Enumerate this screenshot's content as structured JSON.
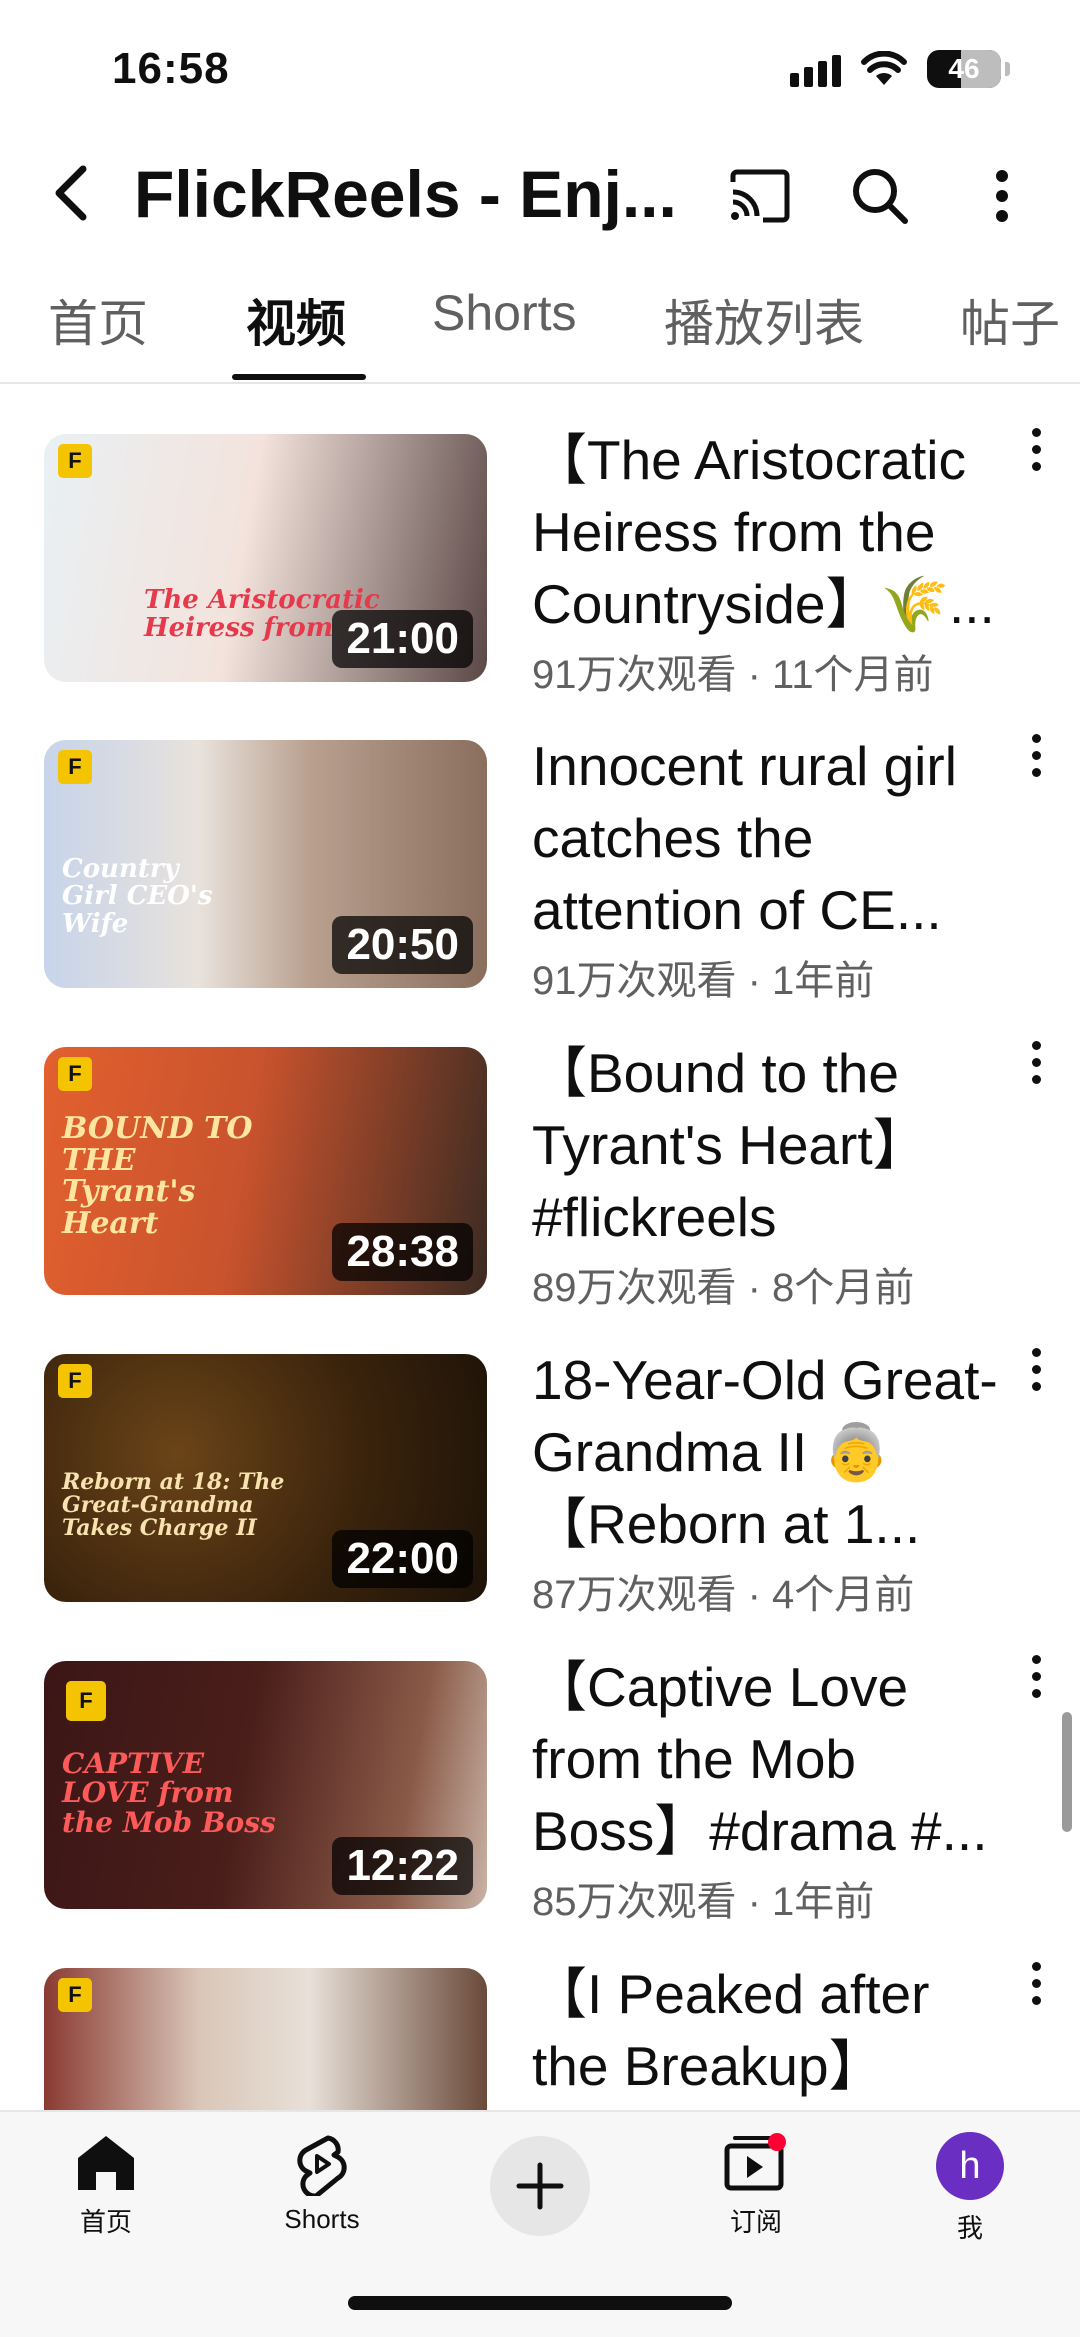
{
  "status_bar": {
    "time": "16:58",
    "battery": "46"
  },
  "header": {
    "channel_title": "FlickReels - Enj..."
  },
  "tabs": [
    {
      "label": "首页"
    },
    {
      "label": "视频"
    },
    {
      "label": "Shorts"
    },
    {
      "label": "播放列表"
    },
    {
      "label": "帖子"
    }
  ],
  "active_tab": "视频",
  "videos": [
    {
      "title": "【The Aristocratic Heiress from the Countryside】🌾...",
      "meta": "91万次观看 · 11个月前",
      "duration": "21:00",
      "thumb_text": "The Aristocratic Heiress from",
      "thumb_colors": [
        "#f3e7e3",
        "#5a4a48"
      ]
    },
    {
      "title": "Innocent rural girl catches the attention of CE...",
      "meta": "91万次观看 · 1年前",
      "duration": "20:50",
      "thumb_text": "Country Girl CEO's Wife",
      "thumb_colors": [
        "#c9d6ec",
        "#8c7464"
      ]
    },
    {
      "title": "【Bound to the Tyrant's Heart】#flickreels",
      "meta": "89万次观看 · 8个月前",
      "duration": "28:38",
      "thumb_text": "BOUND TO THE Tyrant's Heart",
      "thumb_colors": [
        "#d5562c",
        "#3a2a20"
      ]
    },
    {
      "title": "18-Year-Old Great-Grandma II 👵【Reborn at 1...",
      "meta": "87万次观看 · 4个月前",
      "duration": "22:00",
      "thumb_text": "Reborn at 18: The Great-Grandma Takes Charge II",
      "thumb_colors": [
        "#4a2a12",
        "#1e1408"
      ]
    },
    {
      "title": "【Captive Love from the Mob Boss】#drama #...",
      "meta": "85万次观看 · 1年前",
      "duration": "12:22",
      "thumb_text": "CAPTIVE LOVE from the Mob Boss",
      "thumb_colors": [
        "#3a1414",
        "#7a4a3a"
      ]
    },
    {
      "title": "【I Peaked after the Breakup】",
      "meta": "",
      "duration": "",
      "thumb_text": "",
      "thumb_colors": [
        "#c9a68a",
        "#6a4a3a"
      ]
    }
  ],
  "bottom_nav": {
    "home": "首页",
    "shorts": "Shorts",
    "subscriptions": "订阅",
    "you": "我",
    "avatar_letter": "h"
  },
  "colors": {
    "accent_red": "#ff0033",
    "avatar": "#6a2fc2"
  }
}
